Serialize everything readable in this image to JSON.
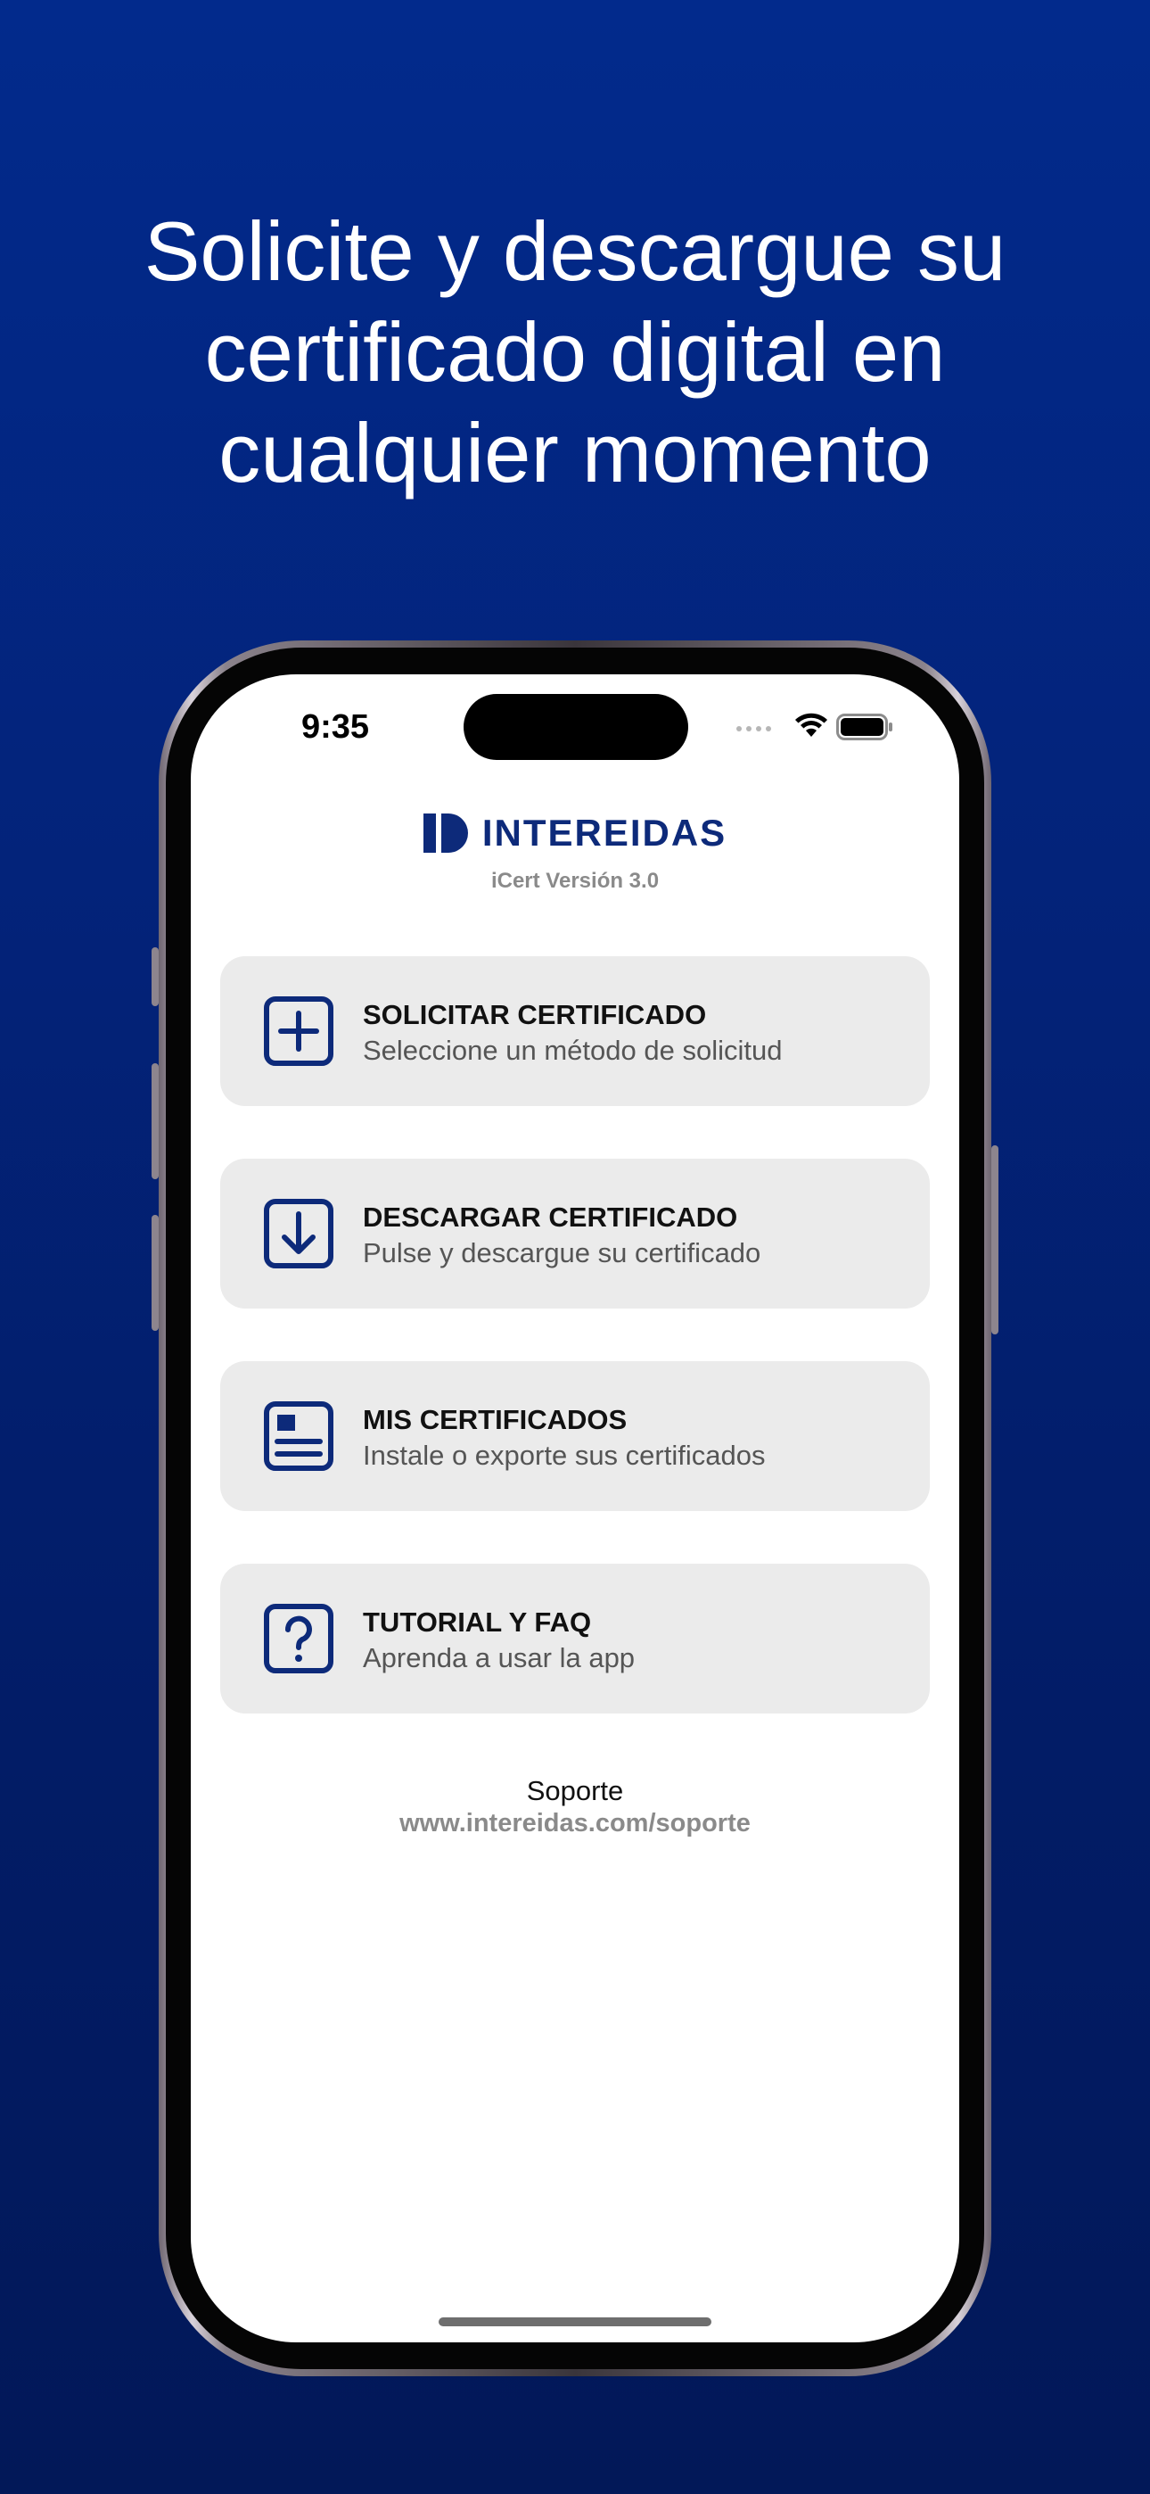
{
  "headline": {
    "line1": "Solicite y descargue su",
    "line2": "certificado digital en",
    "line3": "cualquier momento"
  },
  "status_bar": {
    "time": "9:35",
    "icons": [
      "cellular-dots-icon",
      "wifi-icon",
      "battery-icon"
    ]
  },
  "app": {
    "logo_text": "INTEREIDAS",
    "version": "iCert Versión 3.0",
    "brand_color": "#0d2a7a",
    "card_background": "#ebebeb"
  },
  "menu": [
    {
      "icon": "plus-square-icon",
      "title": "SOLICITAR CERTIFICADO",
      "subtitle": "Seleccione un método de solicitud"
    },
    {
      "icon": "download-square-icon",
      "title": "DESCARGAR CERTIFICADO",
      "subtitle": "Pulse y descargue su certificado"
    },
    {
      "icon": "certificate-card-icon",
      "title": "MIS CERTIFICADOS",
      "subtitle": "Instale o exporte sus certificados"
    },
    {
      "icon": "question-square-icon",
      "title": "TUTORIAL Y FAQ",
      "subtitle": "Aprenda a usar la app"
    }
  ],
  "support": {
    "label": "Soporte",
    "url": "www.intereidas.com/soporte"
  }
}
